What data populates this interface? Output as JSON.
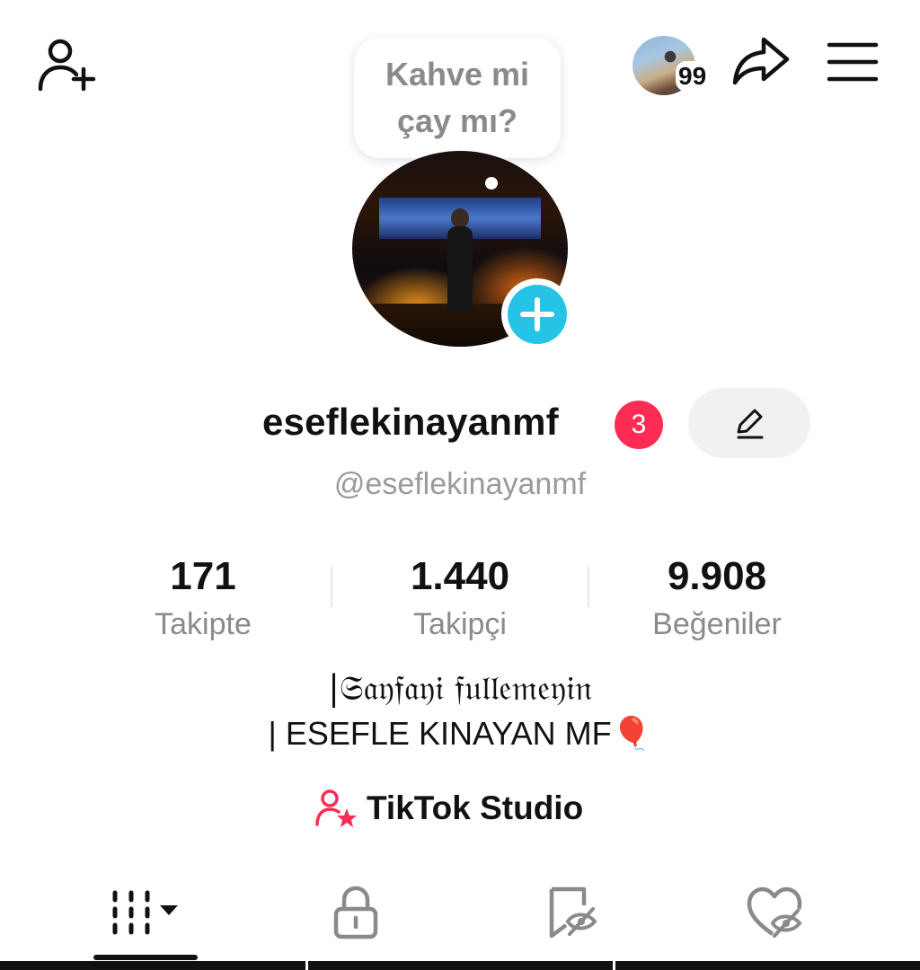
{
  "top_bar": {
    "add_friend_icon": "person-plus-icon",
    "story_count": "99",
    "share_icon": "share-arrow-icon",
    "menu_icon": "hamburger-icon"
  },
  "bubble": {
    "text": "Kahve mi\nçay mı?"
  },
  "profile": {
    "username": "eseflekinayanmf",
    "notification_count": "3",
    "handle": "@eseflekinayanmf",
    "edit_icon": "pencil-icon"
  },
  "stats": [
    {
      "value": "171",
      "label": "Takipte"
    },
    {
      "value": "1.440",
      "label": "Takipçi"
    },
    {
      "value": "9.908",
      "label": "Beğeniler"
    }
  ],
  "bio": {
    "line1": "|𝔖𝔞𝔶𝔣𝔞𝔶𝔦 𝔣𝔲𝔩𝔩𝔢𝔪𝔢𝔶𝔦𝔫",
    "line2": "| ESEFLE KINAYAN MF🎈"
  },
  "studio": {
    "label": "TikTok Studio",
    "icon": "creator-star-icon"
  },
  "tabs": [
    {
      "icon": "grid-videos-icon",
      "active": true
    },
    {
      "icon": "lock-icon",
      "active": false
    },
    {
      "icon": "saved-hidden-icon",
      "active": false
    },
    {
      "icon": "liked-hidden-icon",
      "active": false
    }
  ],
  "colors": {
    "accent": "#fe2c55",
    "plus": "#25c4e7",
    "text": "#111111",
    "muted": "#8a8a8a"
  }
}
